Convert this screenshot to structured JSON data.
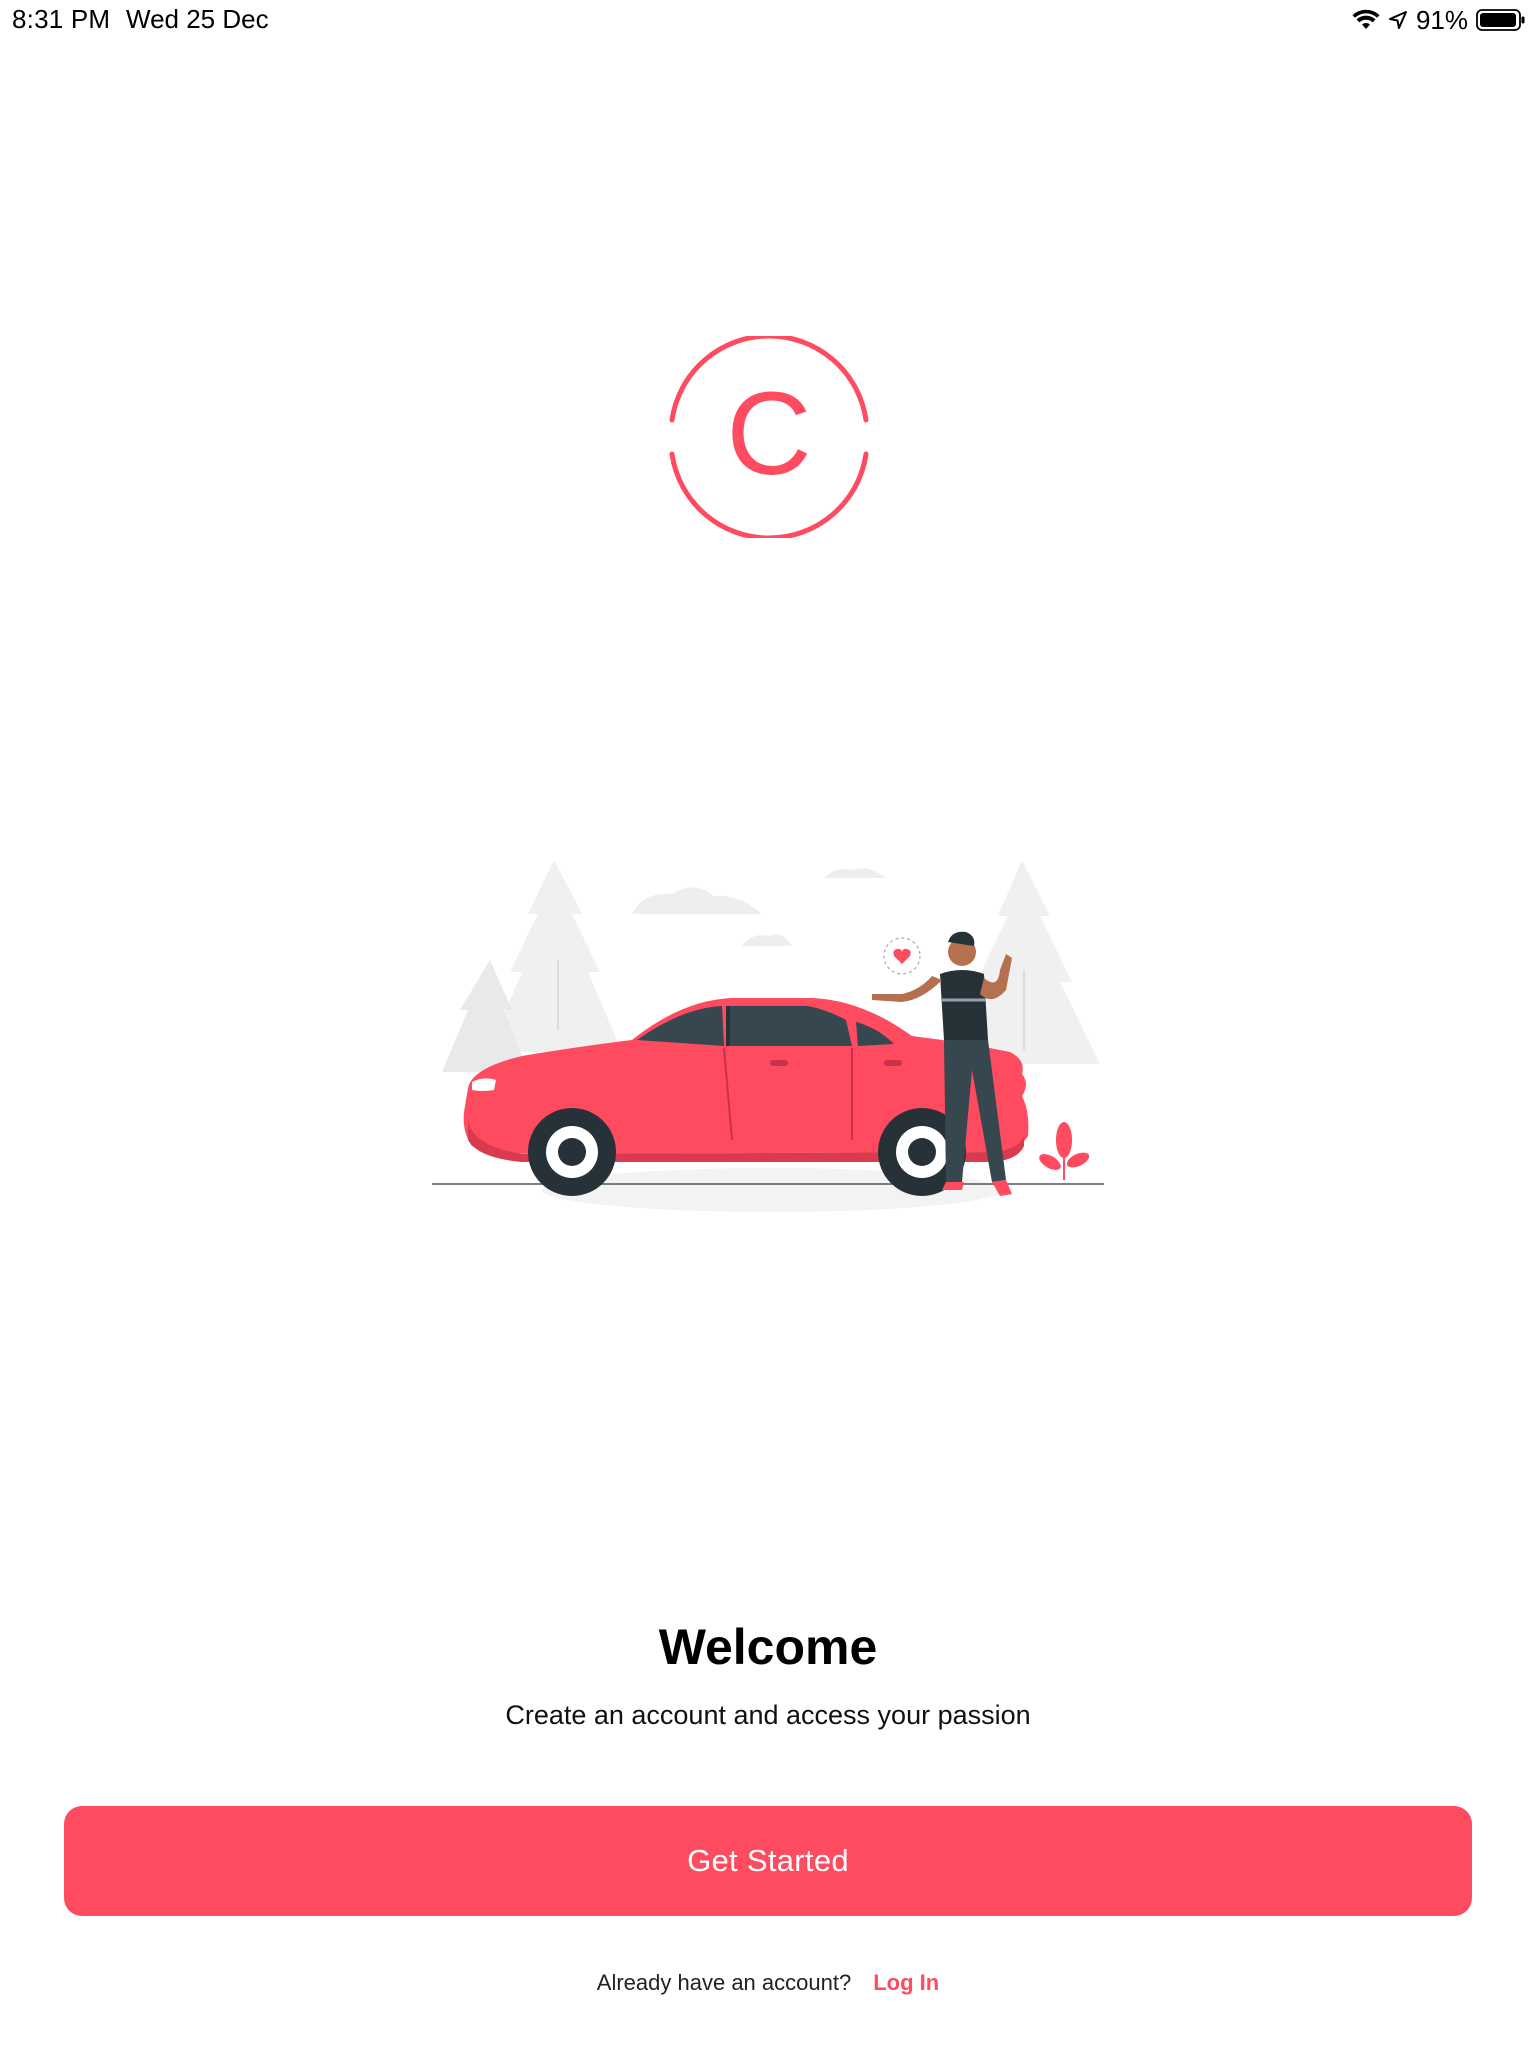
{
  "status_bar": {
    "time": "8:31 PM",
    "date": "Wed 25 Dec",
    "battery_percent": "91%",
    "icons": [
      "wifi-icon",
      "location-icon",
      "battery-icon"
    ]
  },
  "logo": {
    "letter": "C",
    "color": "#ff4b60"
  },
  "illustration": {
    "icon": "car-illustration"
  },
  "welcome": {
    "title": "Welcome",
    "subtitle": "Create an account and access your passion"
  },
  "cta": {
    "label": "Get Started",
    "color": "#ff4b60"
  },
  "login": {
    "prompt": "Already have an account?",
    "link_label": "Log In"
  }
}
